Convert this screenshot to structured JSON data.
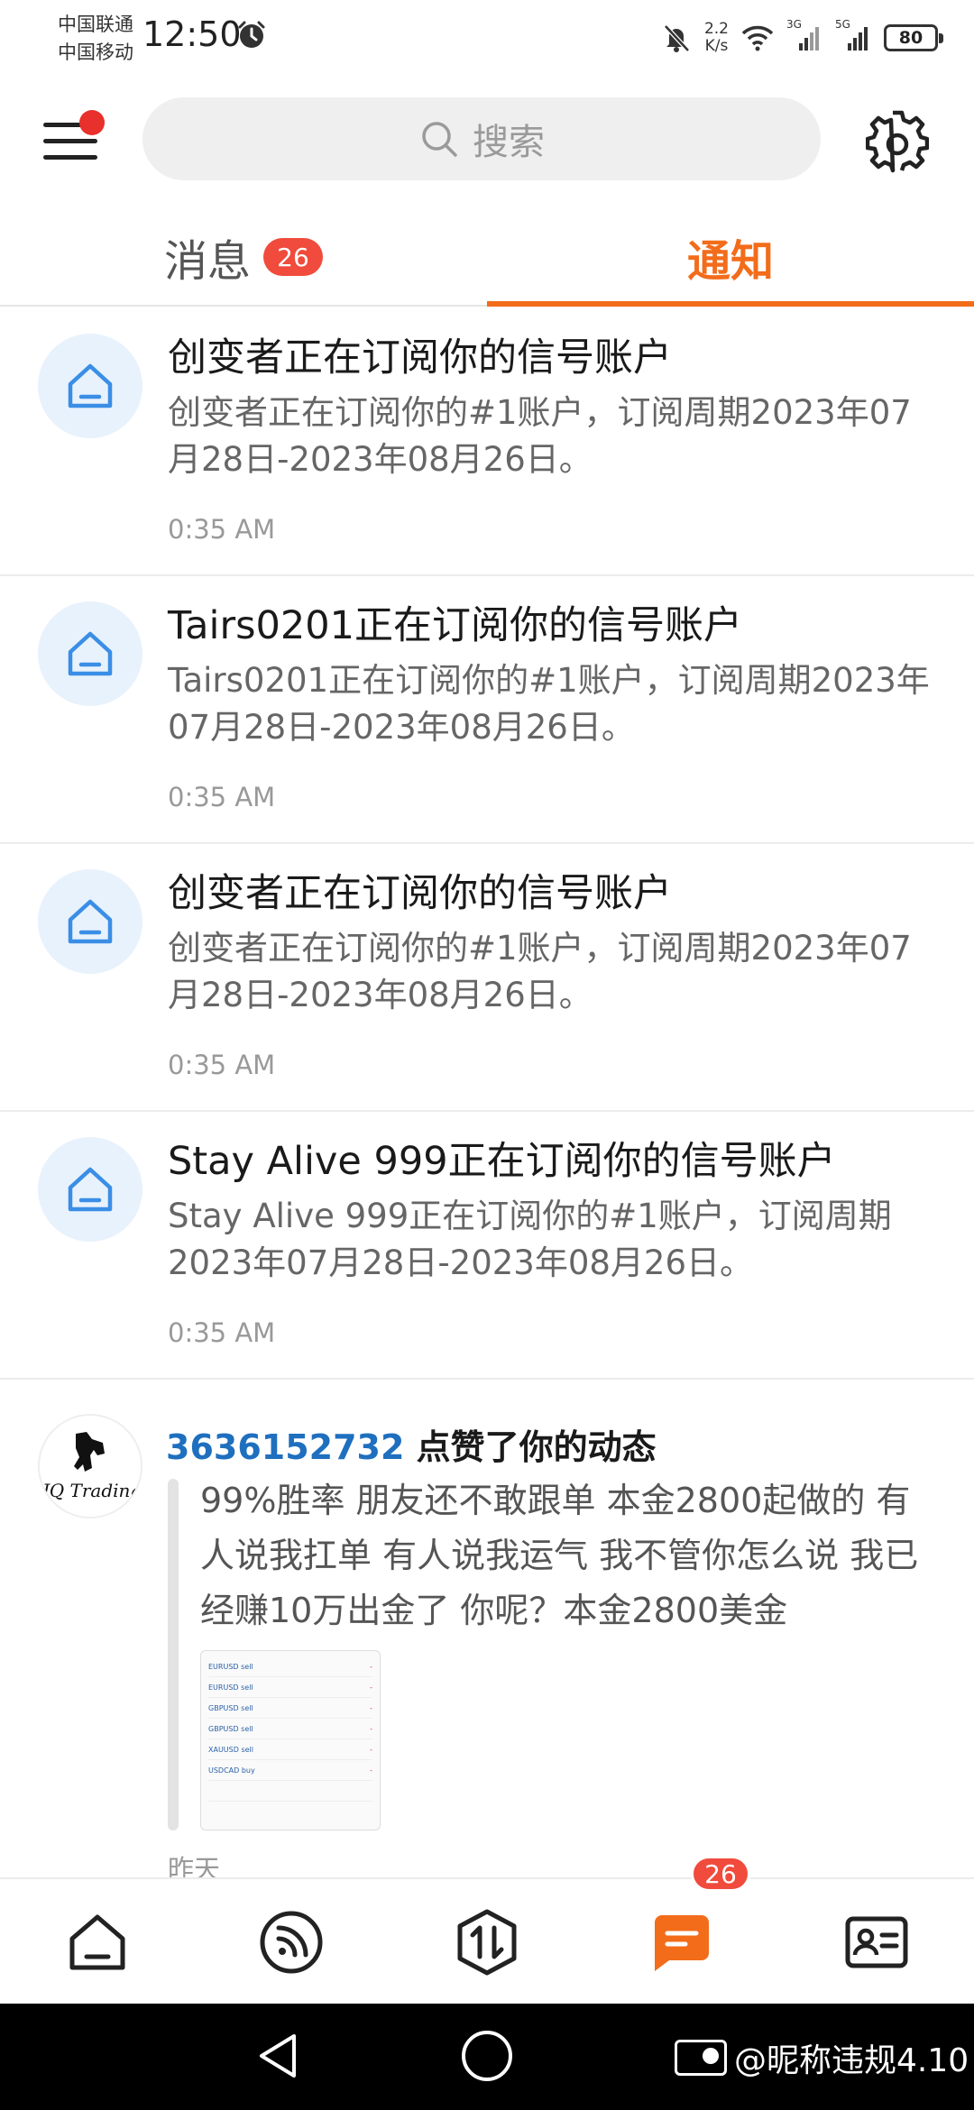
{
  "status_bar": {
    "carrier_1": "中国联通",
    "carrier_2": "中国移动",
    "time": "12:50",
    "speed_value": "2.2",
    "speed_unit": "K/s",
    "signal_1": "3G",
    "signal_2": "5G",
    "battery": "80"
  },
  "header": {
    "search_placeholder": "搜索",
    "menu_has_badge": true
  },
  "tabs": [
    {
      "label": "消息",
      "badge": "26",
      "active": false
    },
    {
      "label": "通知",
      "active": true
    }
  ],
  "notifications": [
    {
      "title": "创变者正在订阅你的信号账户",
      "body": "创变者正在订阅你的#1账户，订阅周期2023年07月28日-2023年08月26日。",
      "time": "0:35 AM",
      "icon": "home-icon"
    },
    {
      "title": "Tairs0201正在订阅你的信号账户",
      "body": "Tairs0201正在订阅你的#1账户，订阅周期2023年07月28日-2023年08月26日。",
      "time": "0:35 AM",
      "icon": "home-icon"
    },
    {
      "title": "创变者正在订阅你的信号账户",
      "body": "创变者正在订阅你的#1账户，订阅周期2023年07月28日-2023年08月26日。",
      "time": "0:35 AM",
      "icon": "home-icon"
    },
    {
      "title": "Stay Alive 999正在订阅你的信号账户",
      "body": "Stay Alive 999正在订阅你的#1账户，订阅周期2023年07月28日-2023年08月26日。",
      "time": "0:35 AM",
      "icon": "home-icon"
    }
  ],
  "like_notification": {
    "user": "3636152732",
    "action": " 点赞了你的动态",
    "quote": "99%胜率 朋友还不敢跟单 本金2800起做的 有人说我扛单 有人说我运气 我不管你怎么说 我已经赚10万出金了 你呢？本金2800美金",
    "time": "昨天",
    "avatar_text": "JQ Trading"
  },
  "bottom_nav": {
    "items": [
      "home-icon",
      "feed-icon",
      "trade-icon",
      "message-icon",
      "profile-card-icon"
    ],
    "active_index": 3,
    "message_badge": "26"
  },
  "watermark": "@昵称违规4.10",
  "colors": {
    "accent": "#f26c1a",
    "badge": "#f04b3c",
    "link": "#1f6fbf",
    "icon_blue": "#3a8ee6"
  }
}
